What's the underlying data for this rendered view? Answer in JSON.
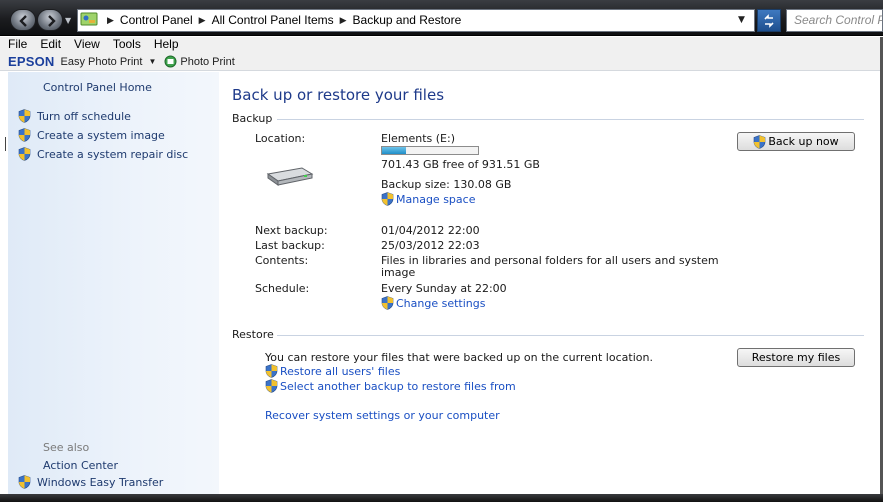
{
  "window": {
    "breadcrumb": [
      "Control Panel",
      "All Control Panel Items",
      "Backup and Restore"
    ],
    "search_placeholder": "Search Control Pa"
  },
  "menu": [
    "File",
    "Edit",
    "View",
    "Tools",
    "Help"
  ],
  "epson": {
    "brand": "EPSON",
    "easy_photo_print": "Easy Photo Print",
    "photo_print": "Photo Print"
  },
  "sidebar": {
    "home": "Control Panel Home",
    "tasks": [
      "Turn off schedule",
      "Create a system image",
      "Create a system repair disc"
    ],
    "see_also_label": "See also",
    "see_also": [
      "Action Center",
      "Windows Easy Transfer"
    ]
  },
  "main": {
    "title": "Back up or restore your files",
    "backup": {
      "header": "Backup",
      "location_label": "Location:",
      "location_value": "Elements (E:)",
      "disk_used_fraction": 0.247,
      "free_space": "701.43 GB free of 931.51 GB",
      "backup_size": "Backup size: 130.08 GB",
      "manage_space": "Manage space",
      "back_up_now": "Back up now",
      "next_backup_label": "Next backup:",
      "next_backup_value": "01/04/2012 22:00",
      "last_backup_label": "Last backup:",
      "last_backup_value": "25/03/2012 22:03",
      "contents_label": "Contents:",
      "contents_value_line1": "Files in libraries and personal folders for all users and system",
      "contents_value_line2": "image",
      "schedule_label": "Schedule:",
      "schedule_value": "Every Sunday at 22:00",
      "change_settings": "Change settings"
    },
    "restore": {
      "header": "Restore",
      "description": "You can restore your files that were backed up on the current location.",
      "restore_all": "Restore all users' files",
      "select_another": "Select another backup to restore files from",
      "recover": "Recover system settings or your computer",
      "restore_my_files": "Restore my files"
    }
  },
  "colors": {
    "link": "#1a4fc3",
    "title": "#1e3a8a",
    "sidebar_bg": "#e6eef8",
    "progress": "#1f8ec9"
  }
}
